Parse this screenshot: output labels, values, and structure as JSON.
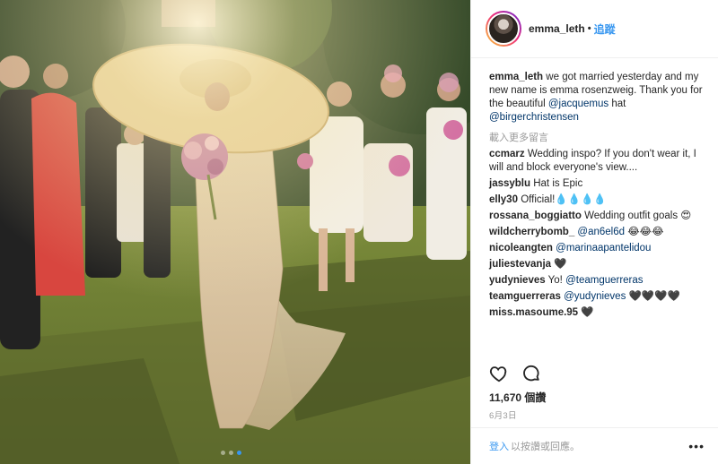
{
  "header": {
    "username": "emma_leth",
    "separator": "•",
    "follow_label": "追蹤"
  },
  "caption": {
    "username": "emma_leth",
    "text": "we got married yesterday and my new name is emma rosenzweig. Thank you for the beautiful",
    "mention1": "@jacquemus",
    "middle": "hat",
    "mention2": "@birgerchristensen"
  },
  "load_more_label": "載入更多留言",
  "comments": [
    {
      "user": "ccmarz",
      "text": "Wedding inspo? If you don't wear it, I will and block everyone's view...."
    },
    {
      "user": "jassyblu",
      "text": "Hat is Epic"
    },
    {
      "user": "elly30",
      "text": "Official!💧💧💧💧"
    },
    {
      "user": "rossana_boggiatto",
      "text": "Wedding outfit goals 😍"
    },
    {
      "user": "wildcherrybomb_",
      "mention": "@an6el6d",
      "text": "😂😂😂"
    },
    {
      "user": "nicoleangten",
      "mention": "@marinaapantelidou",
      "text": ""
    },
    {
      "user": "juliestevanja",
      "text": "🖤"
    },
    {
      "user": "yudynieves",
      "text": "Yo!",
      "mention": "@teamguerreras"
    },
    {
      "user": "teamguerreras",
      "mention": "@yudynieves",
      "text": "🖤🖤🖤🖤"
    },
    {
      "user": "miss.masoume.95",
      "text": "🖤"
    }
  ],
  "actions": {
    "like_icon": "heart-icon",
    "comment_icon": "comment-icon"
  },
  "likes": "11,670 個讚",
  "date": "6月3日",
  "footer": {
    "login_label": "登入",
    "login_suffix": "以按讚或回應。",
    "more_icon": "•••"
  },
  "colors": {
    "link_blue": "#3897f0",
    "mention_blue": "#003569",
    "muted_gray": "#999999",
    "text": "#262626"
  },
  "carousel": {
    "count": 3,
    "active_index": 2
  }
}
